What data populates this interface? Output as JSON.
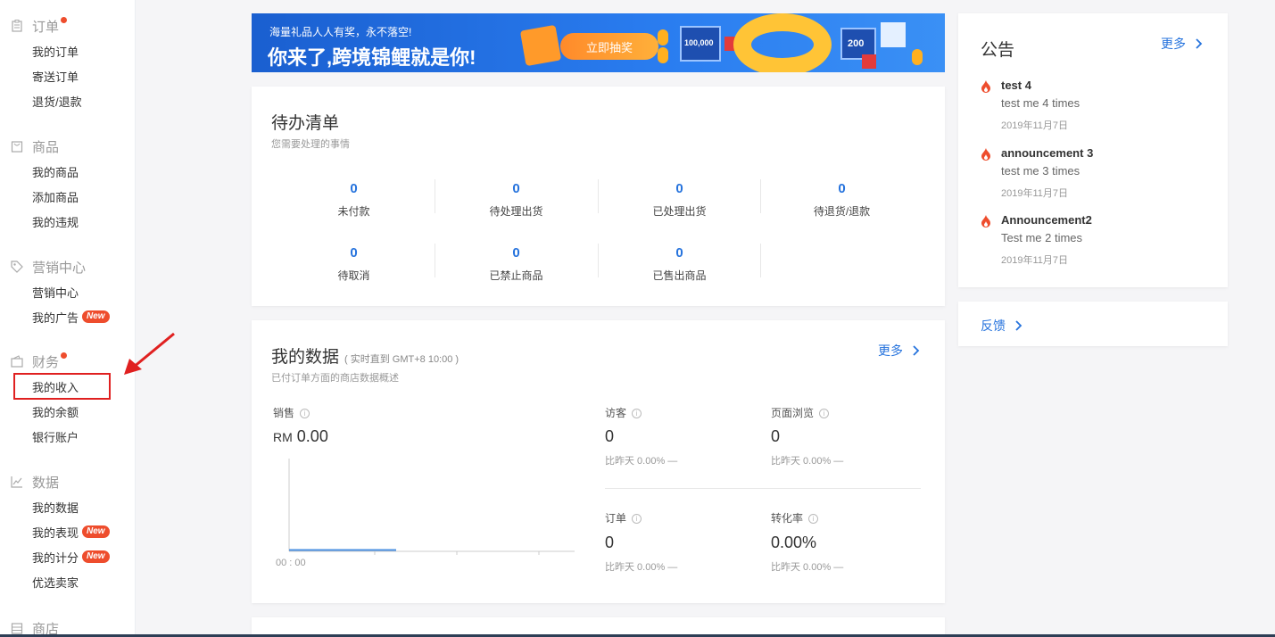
{
  "sidebar": {
    "sections": [
      {
        "title": "订单",
        "icon": "clipboard-icon",
        "dot": true,
        "items": [
          {
            "label": "我的订单"
          },
          {
            "label": "寄送订单"
          },
          {
            "label": "退货/退款"
          }
        ]
      },
      {
        "title": "商品",
        "icon": "bag-icon",
        "dot": false,
        "items": [
          {
            "label": "我的商品"
          },
          {
            "label": "添加商品"
          },
          {
            "label": "我的违规"
          }
        ]
      },
      {
        "title": "营销中心",
        "icon": "tag-icon",
        "dot": false,
        "items": [
          {
            "label": "营销中心"
          },
          {
            "label": "我的广告",
            "badge": "New"
          }
        ]
      },
      {
        "title": "财务",
        "icon": "wallet-icon",
        "dot": true,
        "items": [
          {
            "label": "我的收入"
          },
          {
            "label": "我的余额"
          },
          {
            "label": "银行账户"
          }
        ]
      },
      {
        "title": "数据",
        "icon": "chart-line-icon",
        "dot": false,
        "items": [
          {
            "label": "我的数据"
          },
          {
            "label": "我的表现",
            "badge": "New"
          },
          {
            "label": "我的计分",
            "badge": "New"
          },
          {
            "label": "优选卖家"
          }
        ]
      },
      {
        "title": "商店",
        "icon": "store-icon",
        "dot": false,
        "items": []
      }
    ]
  },
  "banner": {
    "small_text": "海量礼品人人有奖，永不落空!",
    "big_text": "你来了,跨境锦鲤就是你!",
    "button_label": "立即抽奖",
    "cube1_text": "100,000",
    "cube2_text": "200"
  },
  "todo": {
    "title": "待办清单",
    "subtitle": "您需要处理的事情",
    "items": [
      {
        "value": "0",
        "label": "未付款"
      },
      {
        "value": "0",
        "label": "待处理出货"
      },
      {
        "value": "0",
        "label": "已处理出货"
      },
      {
        "value": "0",
        "label": "待退货/退款"
      },
      {
        "value": "0",
        "label": "待取消"
      },
      {
        "value": "0",
        "label": "已禁止商品"
      },
      {
        "value": "0",
        "label": "已售出商品"
      }
    ]
  },
  "mydata": {
    "title": "我的数据",
    "realtime": "( 实时直到 GMT+8 10:00 )",
    "subtitle": "已付订单方面的商店数据概述",
    "more_label": "更多",
    "sales": {
      "label": "销售",
      "currency": "RM",
      "value": "0.00"
    },
    "chart_x_label": "00 : 00",
    "metrics": [
      {
        "label": "访客",
        "value": "0",
        "compare": "比昨天 0.00% —"
      },
      {
        "label": "页面浏览",
        "value": "0",
        "compare": "比昨天 0.00% —"
      },
      {
        "label": "订单",
        "value": "0",
        "compare": "比昨天 0.00% —"
      },
      {
        "label": "转化率",
        "value": "0.00%",
        "compare": "比昨天 0.00% —"
      }
    ]
  },
  "announcements": {
    "title": "公告",
    "more_label": "更多",
    "items": [
      {
        "title": "test 4",
        "desc": "test me 4 times",
        "date": "2019年11月7日"
      },
      {
        "title": "announcement 3",
        "desc": "test me 3 times",
        "date": "2019年11月7日"
      },
      {
        "title": "Announcement2",
        "desc": "Test me 2 times",
        "date": "2019年11月7日"
      }
    ]
  },
  "feedback": {
    "label": "反馈"
  },
  "colors": {
    "accent": "#2673dd",
    "brand": "#ee4d2d",
    "highlight": "#e02020"
  }
}
